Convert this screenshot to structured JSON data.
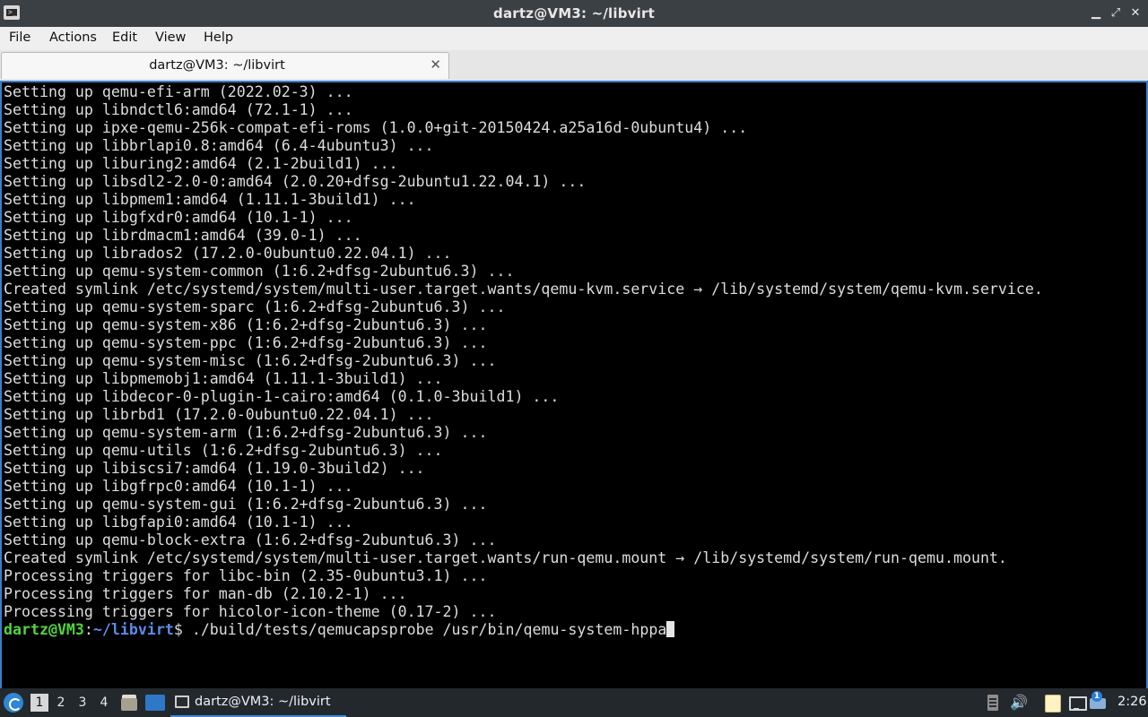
{
  "window": {
    "title": "dartz@VM3: ~/libvirt",
    "minimize_glyph": "▁",
    "maximize_glyph": "⤢",
    "close_glyph": "✕",
    "app_icon_glyph": ">_"
  },
  "menubar": {
    "items": [
      "File",
      "Actions",
      "Edit",
      "View",
      "Help"
    ]
  },
  "tabs": [
    {
      "label": "dartz@VM3: ~/libvirt",
      "close_glyph": "✕"
    }
  ],
  "terminal": {
    "lines": [
      "Setting up qemu-efi-arm (2022.02-3) ...",
      "Setting up libndctl6:amd64 (72.1-1) ...",
      "Setting up ipxe-qemu-256k-compat-efi-roms (1.0.0+git-20150424.a25a16d-0ubuntu4) ...",
      "Setting up libbrlapi0.8:amd64 (6.4-4ubuntu3) ...",
      "Setting up liburing2:amd64 (2.1-2build1) ...",
      "Setting up libsdl2-2.0-0:amd64 (2.0.20+dfsg-2ubuntu1.22.04.1) ...",
      "Setting up libpmem1:amd64 (1.11.1-3build1) ...",
      "Setting up libgfxdr0:amd64 (10.1-1) ...",
      "Setting up librdmacm1:amd64 (39.0-1) ...",
      "Setting up librados2 (17.2.0-0ubuntu0.22.04.1) ...",
      "Setting up qemu-system-common (1:6.2+dfsg-2ubuntu6.3) ...",
      "Created symlink /etc/systemd/system/multi-user.target.wants/qemu-kvm.service → /lib/systemd/system/qemu-kvm.service.",
      "Setting up qemu-system-sparc (1:6.2+dfsg-2ubuntu6.3) ...",
      "Setting up qemu-system-x86 (1:6.2+dfsg-2ubuntu6.3) ...",
      "Setting up qemu-system-ppc (1:6.2+dfsg-2ubuntu6.3) ...",
      "Setting up qemu-system-misc (1:6.2+dfsg-2ubuntu6.3) ...",
      "Setting up libpmemobj1:amd64 (1.11.1-3build1) ...",
      "Setting up libdecor-0-plugin-1-cairo:amd64 (0.1.0-3build1) ...",
      "Setting up librbd1 (17.2.0-0ubuntu0.22.04.1) ...",
      "Setting up qemu-system-arm (1:6.2+dfsg-2ubuntu6.3) ...",
      "Setting up qemu-utils (1:6.2+dfsg-2ubuntu6.3) ...",
      "Setting up libiscsi7:amd64 (1.19.0-3build2) ...",
      "Setting up libgfrpc0:amd64 (10.1-1) ...",
      "Setting up qemu-system-gui (1:6.2+dfsg-2ubuntu6.3) ...",
      "Setting up libgfapi0:amd64 (10.1-1) ...",
      "Setting up qemu-block-extra (1:6.2+dfsg-2ubuntu6.3) ...",
      "Created symlink /etc/systemd/system/multi-user.target.wants/run-qemu.mount → /lib/systemd/system/run-qemu.mount.",
      "Processing triggers for libc-bin (2.35-0ubuntu3.1) ...",
      "Processing triggers for man-db (2.10.2-1) ...",
      "Processing triggers for hicolor-icon-theme (0.17-2) ..."
    ],
    "prompt": {
      "user_host": "dartz@VM3",
      "separator": ":",
      "path": "~/libvirt",
      "symbol": "$ ",
      "command": "./build/tests/qemucapsprobe /usr/bin/qemu-system-hppa"
    }
  },
  "taskbar": {
    "workspaces": [
      "1",
      "2",
      "3",
      "4"
    ],
    "active_workspace": "1",
    "task_label": "dartz@VM3: ~/libvirt",
    "tray": {
      "volume_glyph": "🔊",
      "update_badge": "1"
    },
    "clock": "2:26",
    "icons": [
      "start-menu-icon",
      "file-manager-icon",
      "show-desktop-icon",
      "terminal-icon",
      "clipboard-icon",
      "volume-icon",
      "notes-icon",
      "network-icon",
      "update-notifier-icon"
    ]
  },
  "colors": {
    "titlebar_bg": "#3b4045",
    "menubar_bg": "#efefef",
    "terminal_bg": "#000000",
    "terminal_fg": "#dddddd",
    "terminal_border": "#3d7fc8",
    "prompt_user": "#4fd63c",
    "prompt_path": "#5a8ce8",
    "taskbar_bg": "#23282d"
  }
}
